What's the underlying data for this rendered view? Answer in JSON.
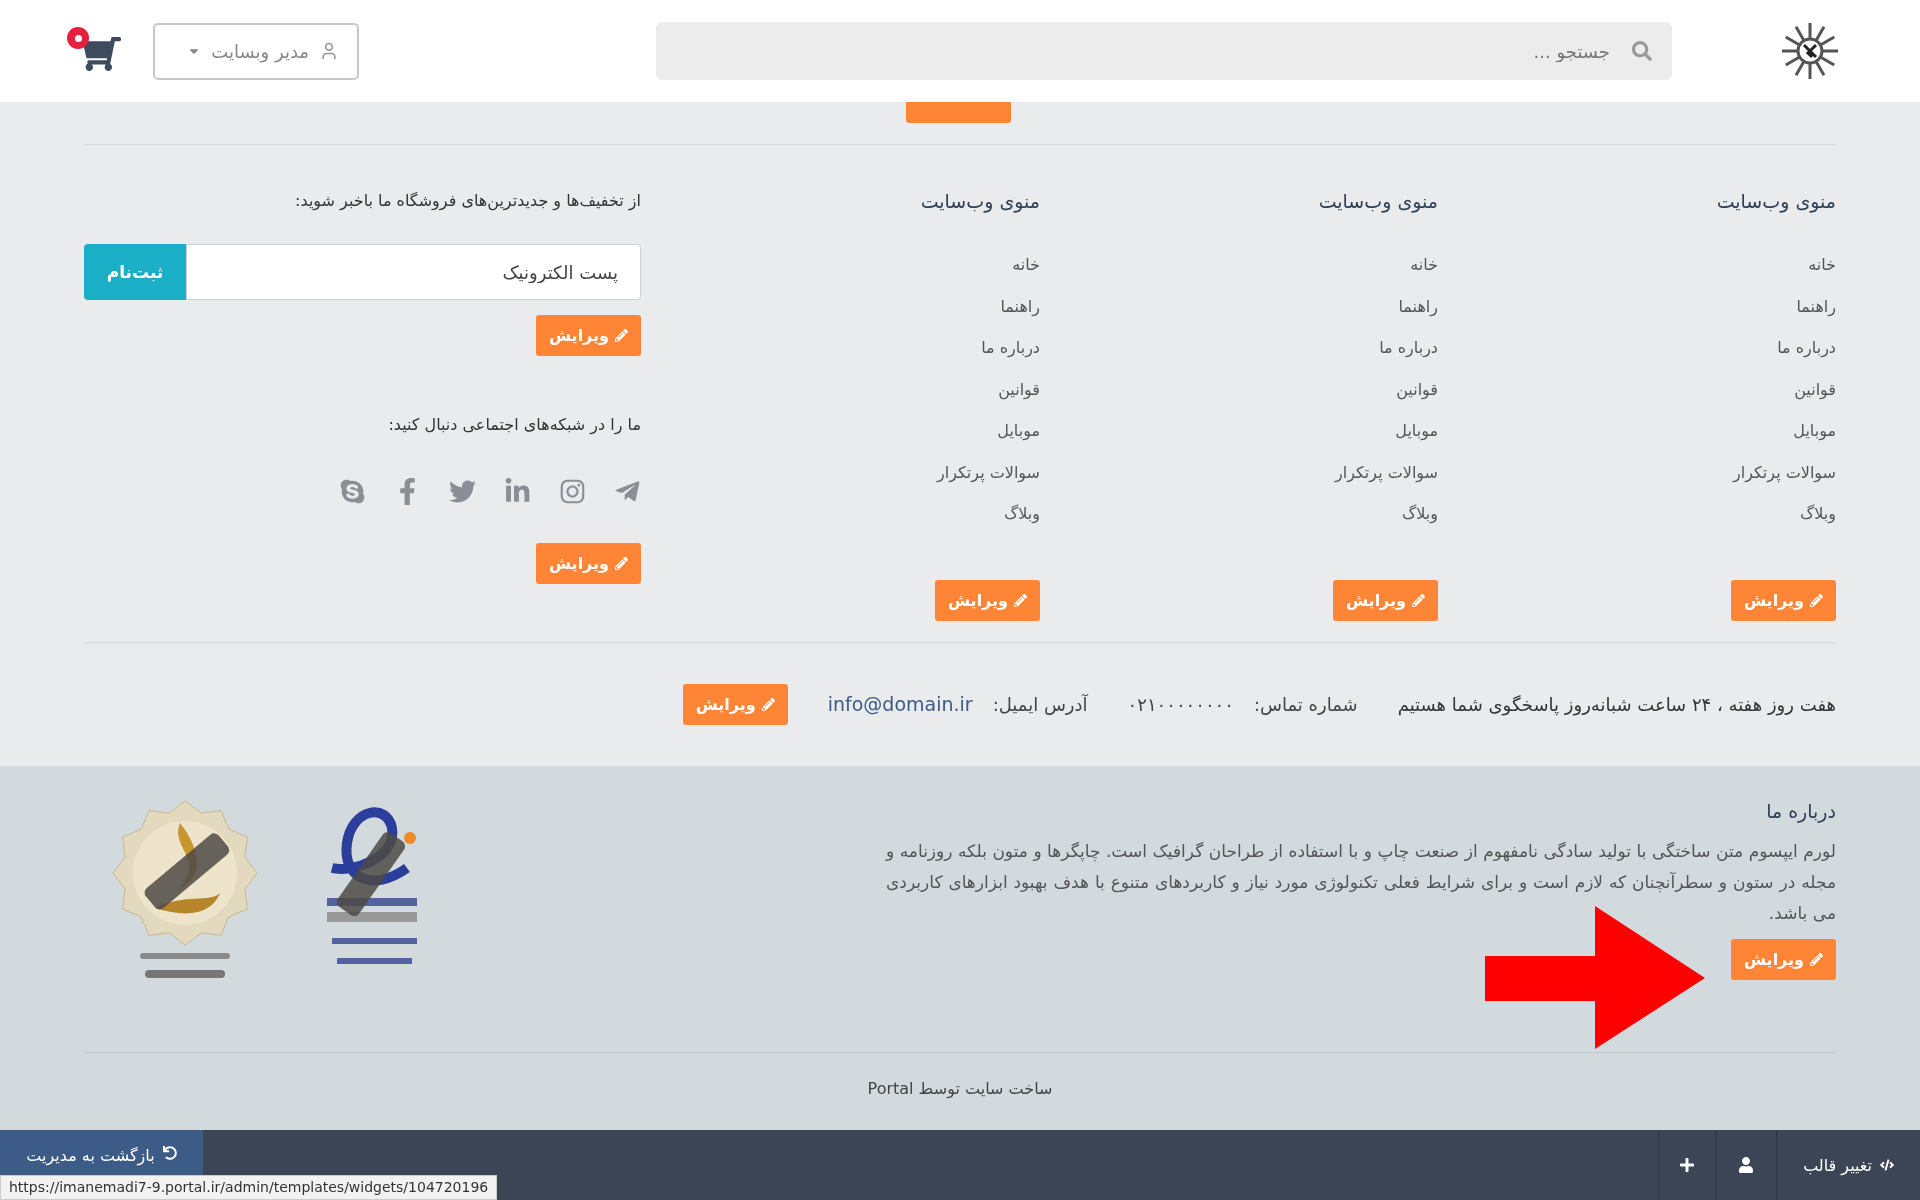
{
  "header": {
    "search": {
      "placeholder": "جستجو ..."
    },
    "user_menu": {
      "label": "مدیر وبسایت"
    }
  },
  "menus": [
    {
      "title": "منوی وب‌سایت",
      "links": [
        "خانه",
        "راهنما",
        "درباره ما",
        "قوانین",
        "موبایل",
        "سوالات پرتکرار",
        "وبلاگ"
      ],
      "edit_label": "ویرایش"
    },
    {
      "title": "منوی وب‌سایت",
      "links": [
        "خانه",
        "راهنما",
        "درباره ما",
        "قوانین",
        "موبایل",
        "سوالات پرتکرار",
        "وبلاگ"
      ],
      "edit_label": "ویرایش"
    },
    {
      "title": "منوی وب‌سایت",
      "links": [
        "خانه",
        "راهنما",
        "درباره ما",
        "قوانین",
        "موبایل",
        "سوالات پرتکرار",
        "وبلاگ"
      ],
      "edit_label": "ویرایش"
    }
  ],
  "newsletter": {
    "title": "از تخفیف‌ها و جدیدترین‌های فروشگاه ما باخبر شوید:",
    "email": {
      "placeholder": "پست الکترونیک"
    },
    "submit": "ثبت‌نام",
    "edit_label": "ویرایش"
  },
  "social": {
    "title": "ما را در شبکه‌های اجتماعی دنبال کنید:",
    "icons": [
      {
        "kind": "telegram"
      },
      {
        "kind": "instagram"
      },
      {
        "kind": "linkedin"
      },
      {
        "kind": "twitter"
      },
      {
        "kind": "facebook"
      },
      {
        "kind": "skype"
      }
    ],
    "edit_label": "ویرایش"
  },
  "contact": {
    "hours": "هفت روز هفته ، ۲۴ ساعت شبانه‌روز پاسخگوی شما هستیم",
    "phone_label": "شماره تماس:",
    "phone": "۰۲۱۰۰۰۰۰۰۰۰",
    "email_label": "آدرس ایمیل:",
    "email": "info@domain.ir",
    "edit_label": "ویرایش"
  },
  "about": {
    "title": "درباره ما",
    "text": "لورم ایپسوم متن ساختگی با تولید سادگی نامفهوم از صنعت چاپ و با استفاده از طراحان گرافیک است. چاپگرها و متون بلکه روزنامه و مجله در ستون و سطرآنچنان که لازم است و برای شرایط فعلی تکنولوژی مورد نیاز و کاربردهای متنوع با هدف بهبود ابزارهای کاربردی می باشد.",
    "edit_label": "ویرایش"
  },
  "credit": "ساخت سایت توسط Portal",
  "admin_bar": {
    "change_template": "تغییر قالب",
    "back_button": "بازگشت به مدیریت"
  },
  "status_url": "https://imanemadi7-9.portal.ir/admin/templates/widgets/104720196"
}
